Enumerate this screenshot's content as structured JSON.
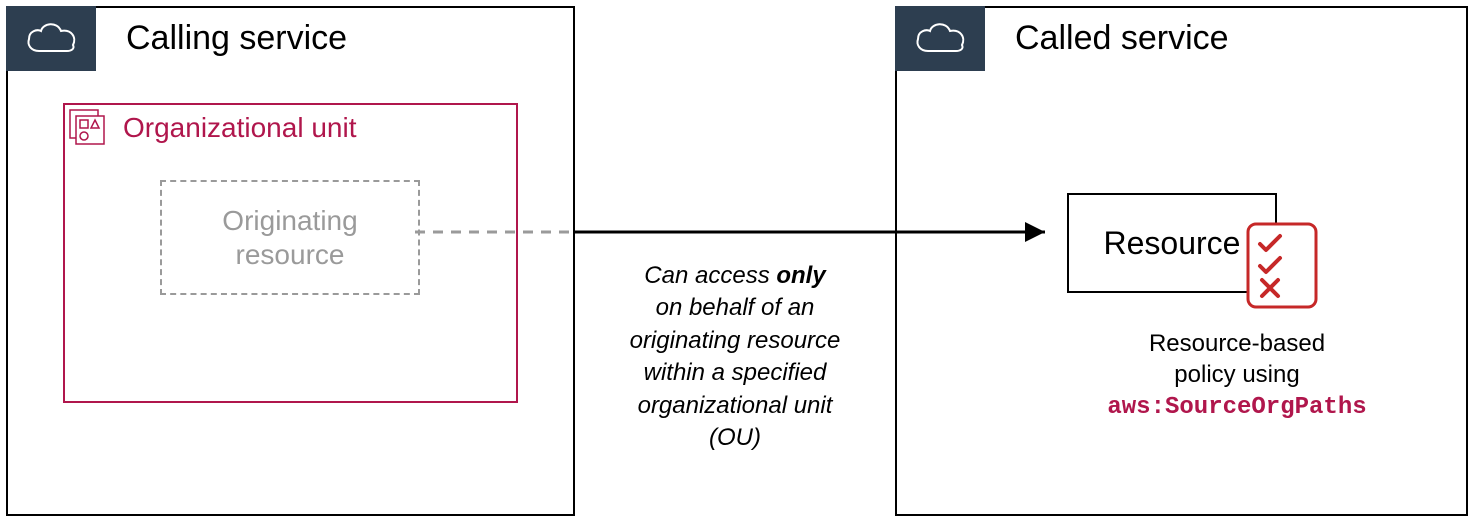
{
  "left": {
    "title": "Calling service",
    "ou_title": "Organizational unit",
    "originating": "Originating\nresource"
  },
  "right": {
    "title": "Called service",
    "resource": "Resource",
    "policy_line1": "Resource-based",
    "policy_line2": "policy using",
    "policy_key": "aws:SourceOrgPaths"
  },
  "center": {
    "line1a": "Can access ",
    "line1b": "only",
    "line2": "on behalf of an",
    "line3": "originating resource",
    "line4": "within a specified",
    "line5": "organizational unit",
    "line6": "(OU)"
  }
}
